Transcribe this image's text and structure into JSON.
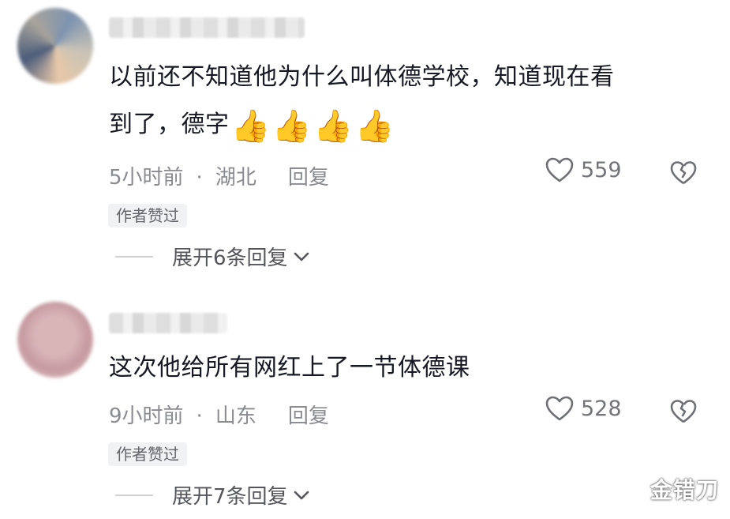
{
  "comments": [
    {
      "text_line1": "以前还不知道他为什么叫体德学校，知道现在看",
      "text_line2": "到了，德字",
      "emojis": [
        "👍",
        "👍",
        "👍",
        "👍"
      ],
      "time": "5小时前",
      "location": "湖北",
      "reply_label": "回复",
      "likes": "559",
      "badge": "作者赞过",
      "expand_label": "展开6条回复"
    },
    {
      "text_line1": "这次他给所有网红上了一节体德课",
      "time": "9小时前",
      "location": "山东",
      "reply_label": "回复",
      "likes": "528",
      "badge": "作者赞过",
      "expand_label": "展开7条回复"
    }
  ],
  "separator": "·",
  "watermark": "金错刀",
  "colors": {
    "text": "#161823",
    "meta": "#8a8b91",
    "badge_bg": "#f1f2f4"
  },
  "icons": [
    "heart-icon",
    "broken-heart-icon",
    "chevron-down-icon",
    "thumbs-up-emoji"
  ]
}
